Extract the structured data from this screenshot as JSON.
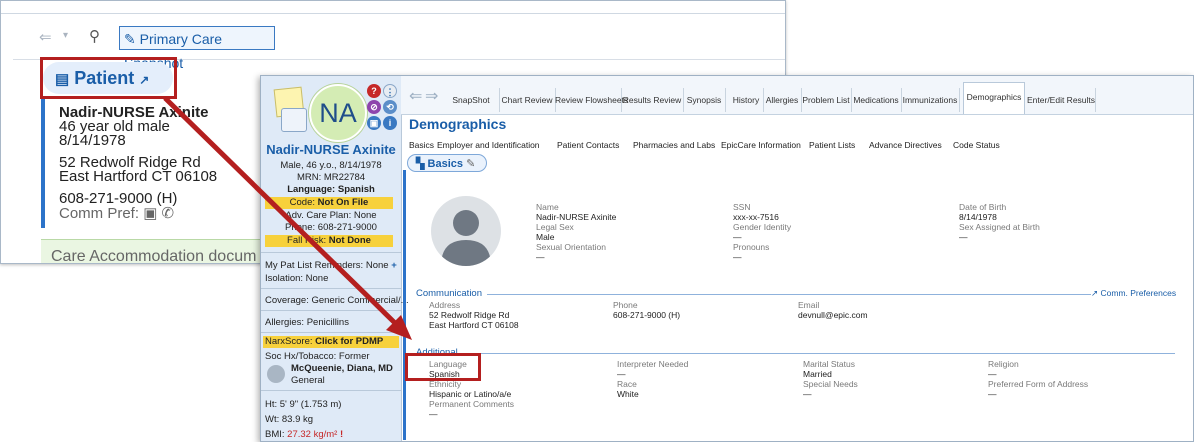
{
  "bg_window": {
    "snapshot_label": "Primary Care Snapshot",
    "patient_section": "Patient",
    "patient_name": "Nadir-NURSE Axinite",
    "patient_age_sex": "46 year old male",
    "patient_dob": "8/14/1978",
    "address_line1": "52 Redwolf Ridge Rd",
    "address_line2": "East Hartford CT 06108",
    "phone": "608-271-9000 (H)",
    "comm_pref_label": "Comm Pref:",
    "care_banner": "Care Accommodation docum"
  },
  "sidebar": {
    "initials": "NA",
    "name": "Nadir-NURSE Axinite",
    "summary": "Male, 46 y.o., 8/14/1978",
    "mrn": "MRN: MR22784",
    "language": "Language: Spanish",
    "code_label": "Code: ",
    "code_value": "Not On File",
    "adv_care": "Adv. Care Plan: None",
    "phone": "Phone: 608-271-9000",
    "fall_label": "Fall Risk: ",
    "fall_value": "Not Done",
    "pat_list": "My Pat List Reminders: None",
    "pat_list_add": "+",
    "isolation": "Isolation: None",
    "coverage": "Coverage: Generic Commercial/...",
    "allergies": "Allergies: Penicillins",
    "narx_label": "NarxScore: ",
    "narx_value": "Click for PDMP",
    "soc_hx": "Soc Hx/Tobacco: Former",
    "pcp_name": "McQueenie, Diana, MD",
    "pcp_role": "General",
    "height": "Ht: 5' 9\" (1.753 m)",
    "weight": "Wt: 83.9 kg",
    "bmi_label": "BMI: ",
    "bmi_value": "27.32 kg/m²",
    "bmi_flag": "!"
  },
  "tabs": [
    "SnapShot",
    "Chart Review",
    "Review Flowsheets",
    "Results Review",
    "Synopsis",
    "History",
    "Allergies",
    "Problem List",
    "Medications",
    "Immunizations",
    "Demographics",
    "Enter/Edit Results"
  ],
  "active_tab": "Demographics",
  "page_title": "Demographics",
  "subnav": [
    "Basics",
    "Employer and Identification",
    "Patient Contacts",
    "Pharmacies and Labs",
    "EpicCare Information",
    "Patient Lists",
    "Advance Directives",
    "Code Status"
  ],
  "basics_chip": "Basics",
  "basics": {
    "name_label": "Name",
    "name_value": "Nadir-NURSE Axinite",
    "legal_sex_label": "Legal Sex",
    "legal_sex_value": "Male",
    "sexual_orientation_label": "Sexual Orientation",
    "sexual_orientation_value": "—",
    "ssn_label": "SSN",
    "ssn_value": "xxx-xx-7516",
    "gender_identity_label": "Gender Identity",
    "gender_identity_value": "—",
    "pronouns_label": "Pronouns",
    "pronouns_value": "—",
    "dob_label": "Date of Birth",
    "dob_value": "8/14/1978",
    "sex_at_birth_label": "Sex Assigned at Birth",
    "sex_at_birth_value": "—"
  },
  "communication": {
    "heading": "Communication",
    "prefs_link": "Comm. Preferences",
    "address_label": "Address",
    "address_line1": "52 Redwolf Ridge Rd",
    "address_line2": "East Hartford CT 06108",
    "phone_label": "Phone",
    "phone_value": "608-271-9000 (H)",
    "email_label": "Email",
    "email_value": "devnull@epic.com"
  },
  "additional": {
    "heading": "Additional",
    "language_label": "Language",
    "language_value": "Spanish",
    "interpreter_label": "Interpreter Needed",
    "interpreter_value": "—",
    "marital_label": "Marital Status",
    "marital_value": "Married",
    "religion_label": "Religion",
    "religion_value": "—",
    "ethnicity_label": "Ethnicity",
    "ethnicity_value": "Hispanic or Latino/a/e",
    "race_label": "Race",
    "race_value": "White",
    "special_needs_label": "Special Needs",
    "special_needs_value": "—",
    "form_address_label": "Preferred Form of Address",
    "form_address_value": "—",
    "perm_comments_label": "Permanent Comments",
    "perm_comments_value": "—"
  },
  "colors": {
    "accent": "#1a5ea8",
    "callout": "#b41f1f",
    "alert": "#f7d13c",
    "sidebar": "#dfeaf7"
  }
}
